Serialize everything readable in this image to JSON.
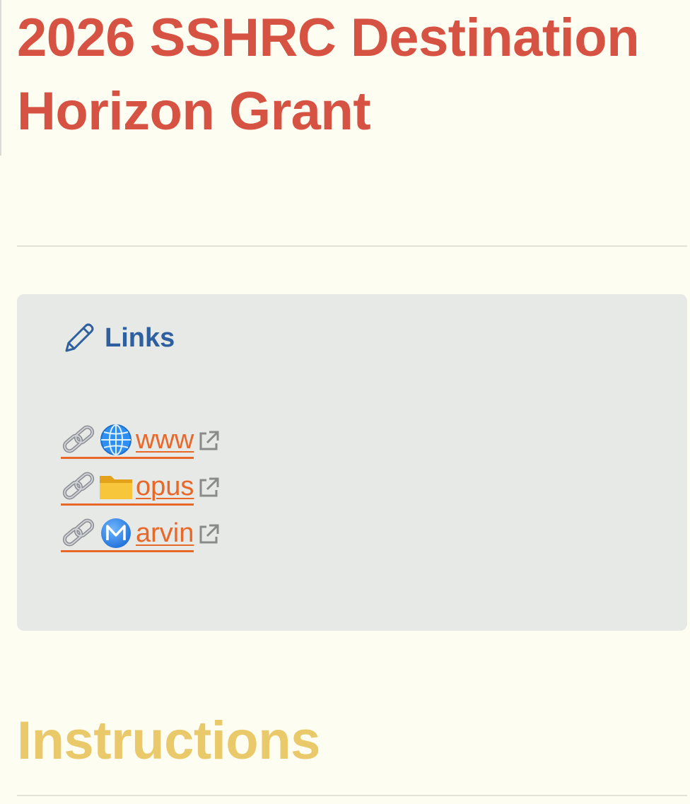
{
  "page": {
    "title": "2026 SSHRC Destination Horizon Grant"
  },
  "callout": {
    "icon": "pencil-icon",
    "title": "Links",
    "items": [
      {
        "link_icon": "chain-link-icon",
        "type_icon": "globe-icon",
        "label": "www",
        "external_icon": "external-link-icon"
      },
      {
        "link_icon": "chain-link-icon",
        "type_icon": "folder-icon",
        "label": "opus",
        "external_icon": "external-link-icon"
      },
      {
        "link_icon": "chain-link-icon",
        "type_icon": "m-circle-icon",
        "label": "arvin",
        "external_icon": "external-link-icon"
      }
    ]
  },
  "sections": {
    "instructions_title": "Instructions"
  },
  "colors": {
    "background": "#fefdf1",
    "title": "#d65243",
    "callout_bg": "#e7e9e6",
    "callout_title": "#2e5f9e",
    "link": "#e8682a",
    "section_heading": "#e9c96a"
  }
}
